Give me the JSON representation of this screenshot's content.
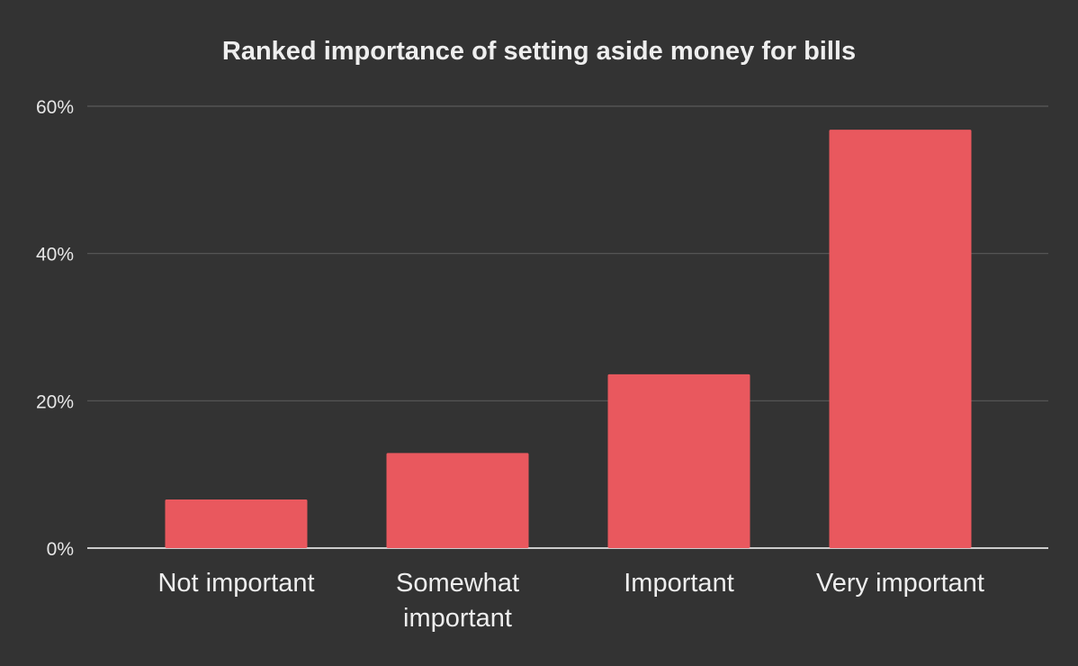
{
  "chart_data": {
    "type": "bar",
    "title": "Ranked importance of setting aside money for bills",
    "categories": [
      "Not important",
      "Somewhat important",
      "Important",
      "Very important"
    ],
    "category_lines": [
      [
        "Not important"
      ],
      [
        "Somewhat",
        "important"
      ],
      [
        "Important"
      ],
      [
        "Very important"
      ]
    ],
    "values": [
      6.6,
      12.9,
      23.6,
      56.8
    ],
    "xlabel": "",
    "ylabel": "",
    "ylim": [
      0,
      60
    ],
    "yticks": [
      0,
      20,
      40,
      60
    ],
    "ytick_labels": [
      "0%",
      "20%",
      "40%",
      "60%"
    ],
    "grid": true,
    "legend": "none",
    "colors": {
      "bar": "#e9585e",
      "background": "#333333",
      "grid": "#5a5a5a",
      "axis": "#ffffff"
    }
  }
}
